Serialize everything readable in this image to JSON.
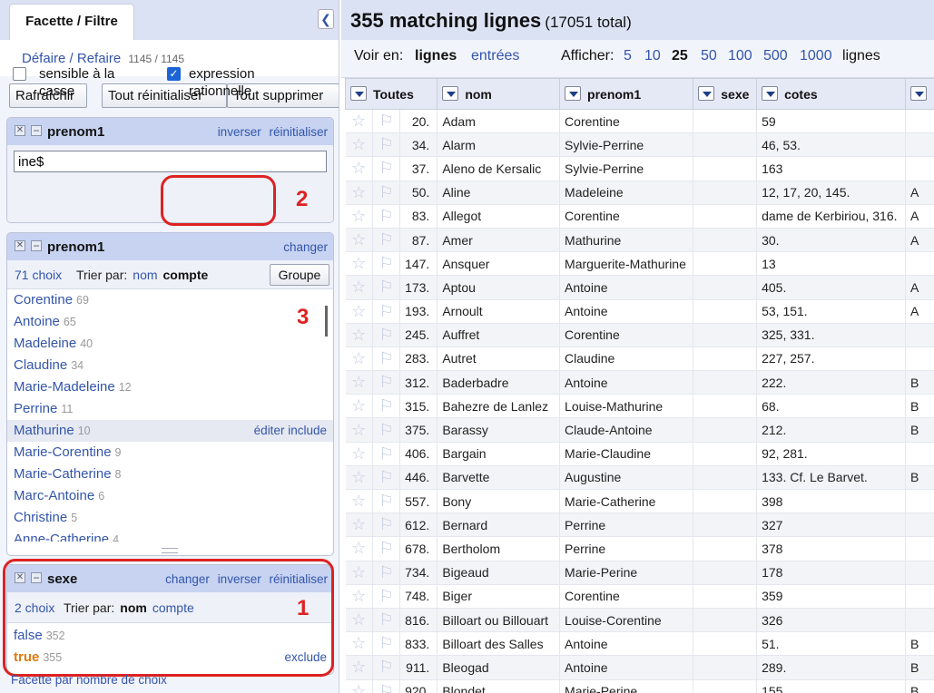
{
  "left": {
    "tab_facet": "Facette / Filtre",
    "undo_link": "Défaire / Refaire",
    "undo_count": "1145 / 1145",
    "buttons": {
      "refresh": "Rafraîchir",
      "reset_all": "Tout réinitialiser",
      "remove_all": "Tout supprimer"
    },
    "facet_text": {
      "title": "prenom1",
      "invert": "inverser",
      "reset": "réinitialiser",
      "input_value": "ine$",
      "case_sensitive": "sensible à la casse",
      "regex": "expression rationnelle",
      "annotation": "2"
    },
    "facet_list": {
      "title": "prenom1",
      "change": "changer",
      "count_label": "71 choix",
      "sort_by": "Trier par:",
      "sort_name": "nom",
      "sort_count": "compte",
      "group_button": "Groupe",
      "annotation": "3",
      "edit": "éditer",
      "include": "include",
      "choices": [
        {
          "name": "Corentine",
          "count": "69"
        },
        {
          "name": "Antoine",
          "count": "65"
        },
        {
          "name": "Madeleine",
          "count": "40"
        },
        {
          "name": "Claudine",
          "count": "34"
        },
        {
          "name": "Marie-Madeleine",
          "count": "12"
        },
        {
          "name": "Perrine",
          "count": "11"
        },
        {
          "name": "Mathurine",
          "count": "10"
        },
        {
          "name": "Marie-Corentine",
          "count": "9"
        },
        {
          "name": "Marie-Catherine",
          "count": "8"
        },
        {
          "name": "Marc-Antoine",
          "count": "6"
        },
        {
          "name": "Christine",
          "count": "5"
        },
        {
          "name": "Anne-Catherine",
          "count": "4"
        }
      ]
    },
    "facet_sexe": {
      "title": "sexe",
      "change": "changer",
      "invert": "inverser",
      "reset": "réinitialiser",
      "count_label": "2 choix",
      "sort_by": "Trier par:",
      "sort_name": "nom",
      "sort_count": "compte",
      "annotation": "1",
      "exclude": "exclude",
      "choices": [
        {
          "name": "false",
          "count": "352"
        },
        {
          "name": "true",
          "count": "355"
        }
      ]
    },
    "facet_by_count": "Facette par nombre de choix"
  },
  "right": {
    "title": "355 matching lignes",
    "total": "(17051 total)",
    "view_label": "Voir en:",
    "view_rows": "lignes",
    "view_records": "entrées",
    "show_label": "Afficher:",
    "page_sizes": [
      "5",
      "10",
      "25",
      "50",
      "100",
      "500",
      "1000"
    ],
    "current_page_size": "25",
    "show_suffix": "lignes",
    "columns": [
      "Toutes",
      "nom",
      "prenom1",
      "sexe",
      "cotes"
    ],
    "rows": [
      [
        "20.",
        "Adam",
        "Corentine",
        "",
        "59",
        ""
      ],
      [
        "34.",
        "Alarm",
        "Sylvie-Perrine",
        "",
        "46, 53.",
        ""
      ],
      [
        "37.",
        "Aleno de Kersalic",
        "Sylvie-Perrine",
        "",
        "163",
        ""
      ],
      [
        "50.",
        "Aline",
        "Madeleine",
        "",
        "12, 17, 20, 145.",
        "A"
      ],
      [
        "83.",
        "Allegot",
        "Corentine",
        "",
        "dame de Kerbiriou, 316.",
        "A"
      ],
      [
        "87.",
        "Amer",
        "Mathurine",
        "",
        "30.",
        "A"
      ],
      [
        "147.",
        "Ansquer",
        "Marguerite-Mathurine",
        "",
        "13",
        ""
      ],
      [
        "173.",
        "Aptou",
        "Antoine",
        "",
        "405.",
        "A"
      ],
      [
        "193.",
        "Arnoult",
        "Antoine",
        "",
        "53, 151.",
        "A"
      ],
      [
        "245.",
        "Auffret",
        "Corentine",
        "",
        "325, 331.",
        ""
      ],
      [
        "283.",
        "Autret",
        "Claudine",
        "",
        "227, 257.",
        ""
      ],
      [
        "312.",
        "Baderbadre",
        "Antoine",
        "",
        "222.",
        "B"
      ],
      [
        "315.",
        "Bahezre de Lanlez",
        "Louise-Mathurine",
        "",
        "68.",
        "B"
      ],
      [
        "375.",
        "Barassy",
        "Claude-Antoine",
        "",
        "212.",
        "B"
      ],
      [
        "406.",
        "Bargain",
        "Marie-Claudine",
        "",
        "92, 281.",
        ""
      ],
      [
        "446.",
        "Barvette",
        "Augustine",
        "",
        "133. Cf. Le Barvet.",
        "B"
      ],
      [
        "557.",
        "Bony",
        "Marie-Catherine",
        "",
        "398",
        ""
      ],
      [
        "612.",
        "Bernard",
        "Perrine",
        "",
        "327",
        ""
      ],
      [
        "678.",
        "Bertholom",
        "Perrine",
        "",
        "378",
        ""
      ],
      [
        "734.",
        "Bigeaud",
        "Marie-Perine",
        "",
        "178",
        ""
      ],
      [
        "748.",
        "Biger",
        "Corentine",
        "",
        "359",
        ""
      ],
      [
        "816.",
        "Billoart ou Billouart",
        "Louise-Corentine",
        "",
        "326",
        ""
      ],
      [
        "833.",
        "Billoart des Salles",
        "Antoine",
        "",
        "51.",
        "B"
      ],
      [
        "911.",
        "Bleogad",
        "Antoine",
        "",
        "289.",
        "B"
      ],
      [
        "920.",
        "Blondet",
        "Marie-Perine",
        "",
        "155",
        "B"
      ]
    ]
  }
}
